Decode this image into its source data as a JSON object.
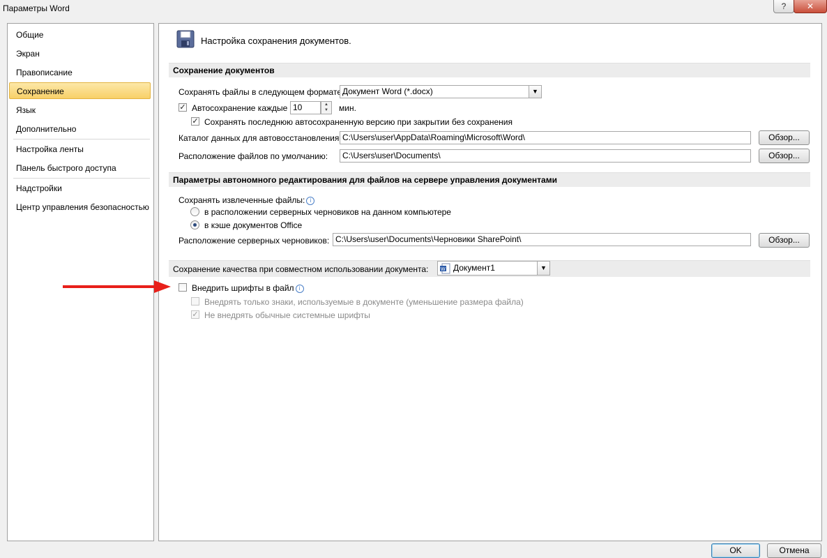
{
  "window": {
    "title": "Параметры Word",
    "help_glyph": "?",
    "close_glyph": "✕"
  },
  "sidebar": {
    "items": [
      {
        "label": "Общие"
      },
      {
        "label": "Экран"
      },
      {
        "label": "Правописание"
      },
      {
        "label": "Сохранение",
        "selected": true
      },
      {
        "label": "Язык"
      },
      {
        "label": "Дополнительно"
      },
      {
        "label": "Настройка ленты"
      },
      {
        "label": "Панель быстрого доступа"
      },
      {
        "label": "Надстройки"
      },
      {
        "label": "Центр управления безопасностью"
      }
    ]
  },
  "main": {
    "header": {
      "icon": "save-floppy-icon",
      "text": "Настройка сохранения документов."
    },
    "save_docs": {
      "title": "Сохранение документов",
      "format_label": "Сохранять файлы в следующем формате:",
      "format_value": "Документ Word (*.docx)",
      "autosave_label": "Автосохранение каждые",
      "autosave_checked": true,
      "autosave_value": "10",
      "autosave_unit": "мин.",
      "keep_last_label": "Сохранять последнюю автосохраненную версию при закрытии без сохранения",
      "keep_last_checked": true,
      "autorecover_label": "Каталог данных для автовосстановления:",
      "autorecover_value": "C:\\Users\\user\\AppData\\Roaming\\Microsoft\\Word\\",
      "default_loc_label": "Расположение файлов по умолчанию:",
      "default_loc_value": "C:\\Users\\user\\Documents\\",
      "browse_label": "Обзор..."
    },
    "offline": {
      "title": "Параметры автономного редактирования для файлов на сервере управления документами",
      "save_checked_out_label": "Сохранять извлеченные файлы:",
      "radio_server_drafts": "в расположении серверных черновиков на данном компьютере",
      "radio_office_cache": "в кэше документов Office",
      "selected_option": "office_cache",
      "drafts_loc_label": "Расположение серверных черновиков:",
      "drafts_loc_value": "C:\\Users\\user\\Documents\\Черновики SharePoint\\",
      "browse_label": "Обзор..."
    },
    "fidelity": {
      "title": "Сохранение качества при совместном использовании документа:",
      "doc_value": "Документ1",
      "embed_fonts_label": "Внедрить шрифты в файл",
      "embed_fonts_checked": false,
      "embed_only_used_label": "Внедрять только знаки, используемые в документе (уменьшение размера файла)",
      "embed_only_used_checked": false,
      "no_common_fonts_label": "Не внедрять обычные системные шрифты",
      "no_common_fonts_checked": true
    }
  },
  "footer": {
    "ok_label": "OK",
    "cancel_label": "Отмена"
  },
  "colors": {
    "selection": "#f8d068",
    "annotation_arrow": "#e8201a",
    "section_bg": "#ececec"
  }
}
